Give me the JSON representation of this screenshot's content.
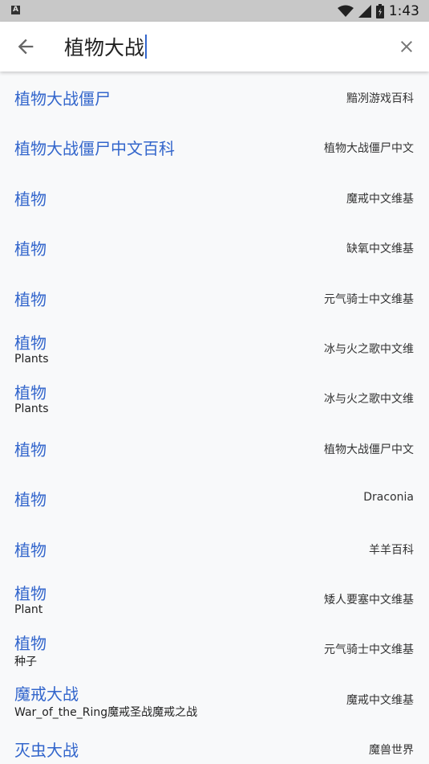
{
  "status_bar": {
    "app_badge": "A",
    "time": "1:43",
    "icons": [
      "wifi-icon",
      "signal-icon",
      "battery-icon"
    ]
  },
  "search": {
    "query": "植物大战",
    "back_icon": "back-arrow-icon",
    "clear_icon": "close-icon",
    "accent_color": "#3366cc"
  },
  "results": [
    {
      "title": "植物大战僵尸",
      "subtitle": "",
      "wiki": "黯冽游戏百科"
    },
    {
      "title": "植物大战僵尸中文百科",
      "subtitle": "",
      "wiki": "植物大战僵尸中文"
    },
    {
      "title": "植物",
      "subtitle": "",
      "wiki": "魔戒中文维基"
    },
    {
      "title": "植物",
      "subtitle": "",
      "wiki": "缺氧中文维基"
    },
    {
      "title": "植物",
      "subtitle": "",
      "wiki": "元气骑士中文维基"
    },
    {
      "title": "植物",
      "subtitle": "Plants",
      "wiki": "冰与火之歌中文维"
    },
    {
      "title": "植物",
      "subtitle": "Plants",
      "wiki": "冰与火之歌中文维"
    },
    {
      "title": "植物",
      "subtitle": "",
      "wiki": "植物大战僵尸中文"
    },
    {
      "title": "植物",
      "subtitle": "",
      "wiki": "Draconia"
    },
    {
      "title": "植物",
      "subtitle": "",
      "wiki": "羊羊百科"
    },
    {
      "title": "植物",
      "subtitle": "Plant",
      "wiki": "矮人要塞中文维基"
    },
    {
      "title": "植物",
      "subtitle": "种子",
      "wiki": "元气骑士中文维基"
    },
    {
      "title": "魔戒大战",
      "subtitle": "War_of_the_Ring魔戒圣战魔戒之战",
      "wiki": "魔戒中文维基"
    },
    {
      "title": "灭虫大战",
      "subtitle": "",
      "wiki": "魔兽世界"
    }
  ]
}
